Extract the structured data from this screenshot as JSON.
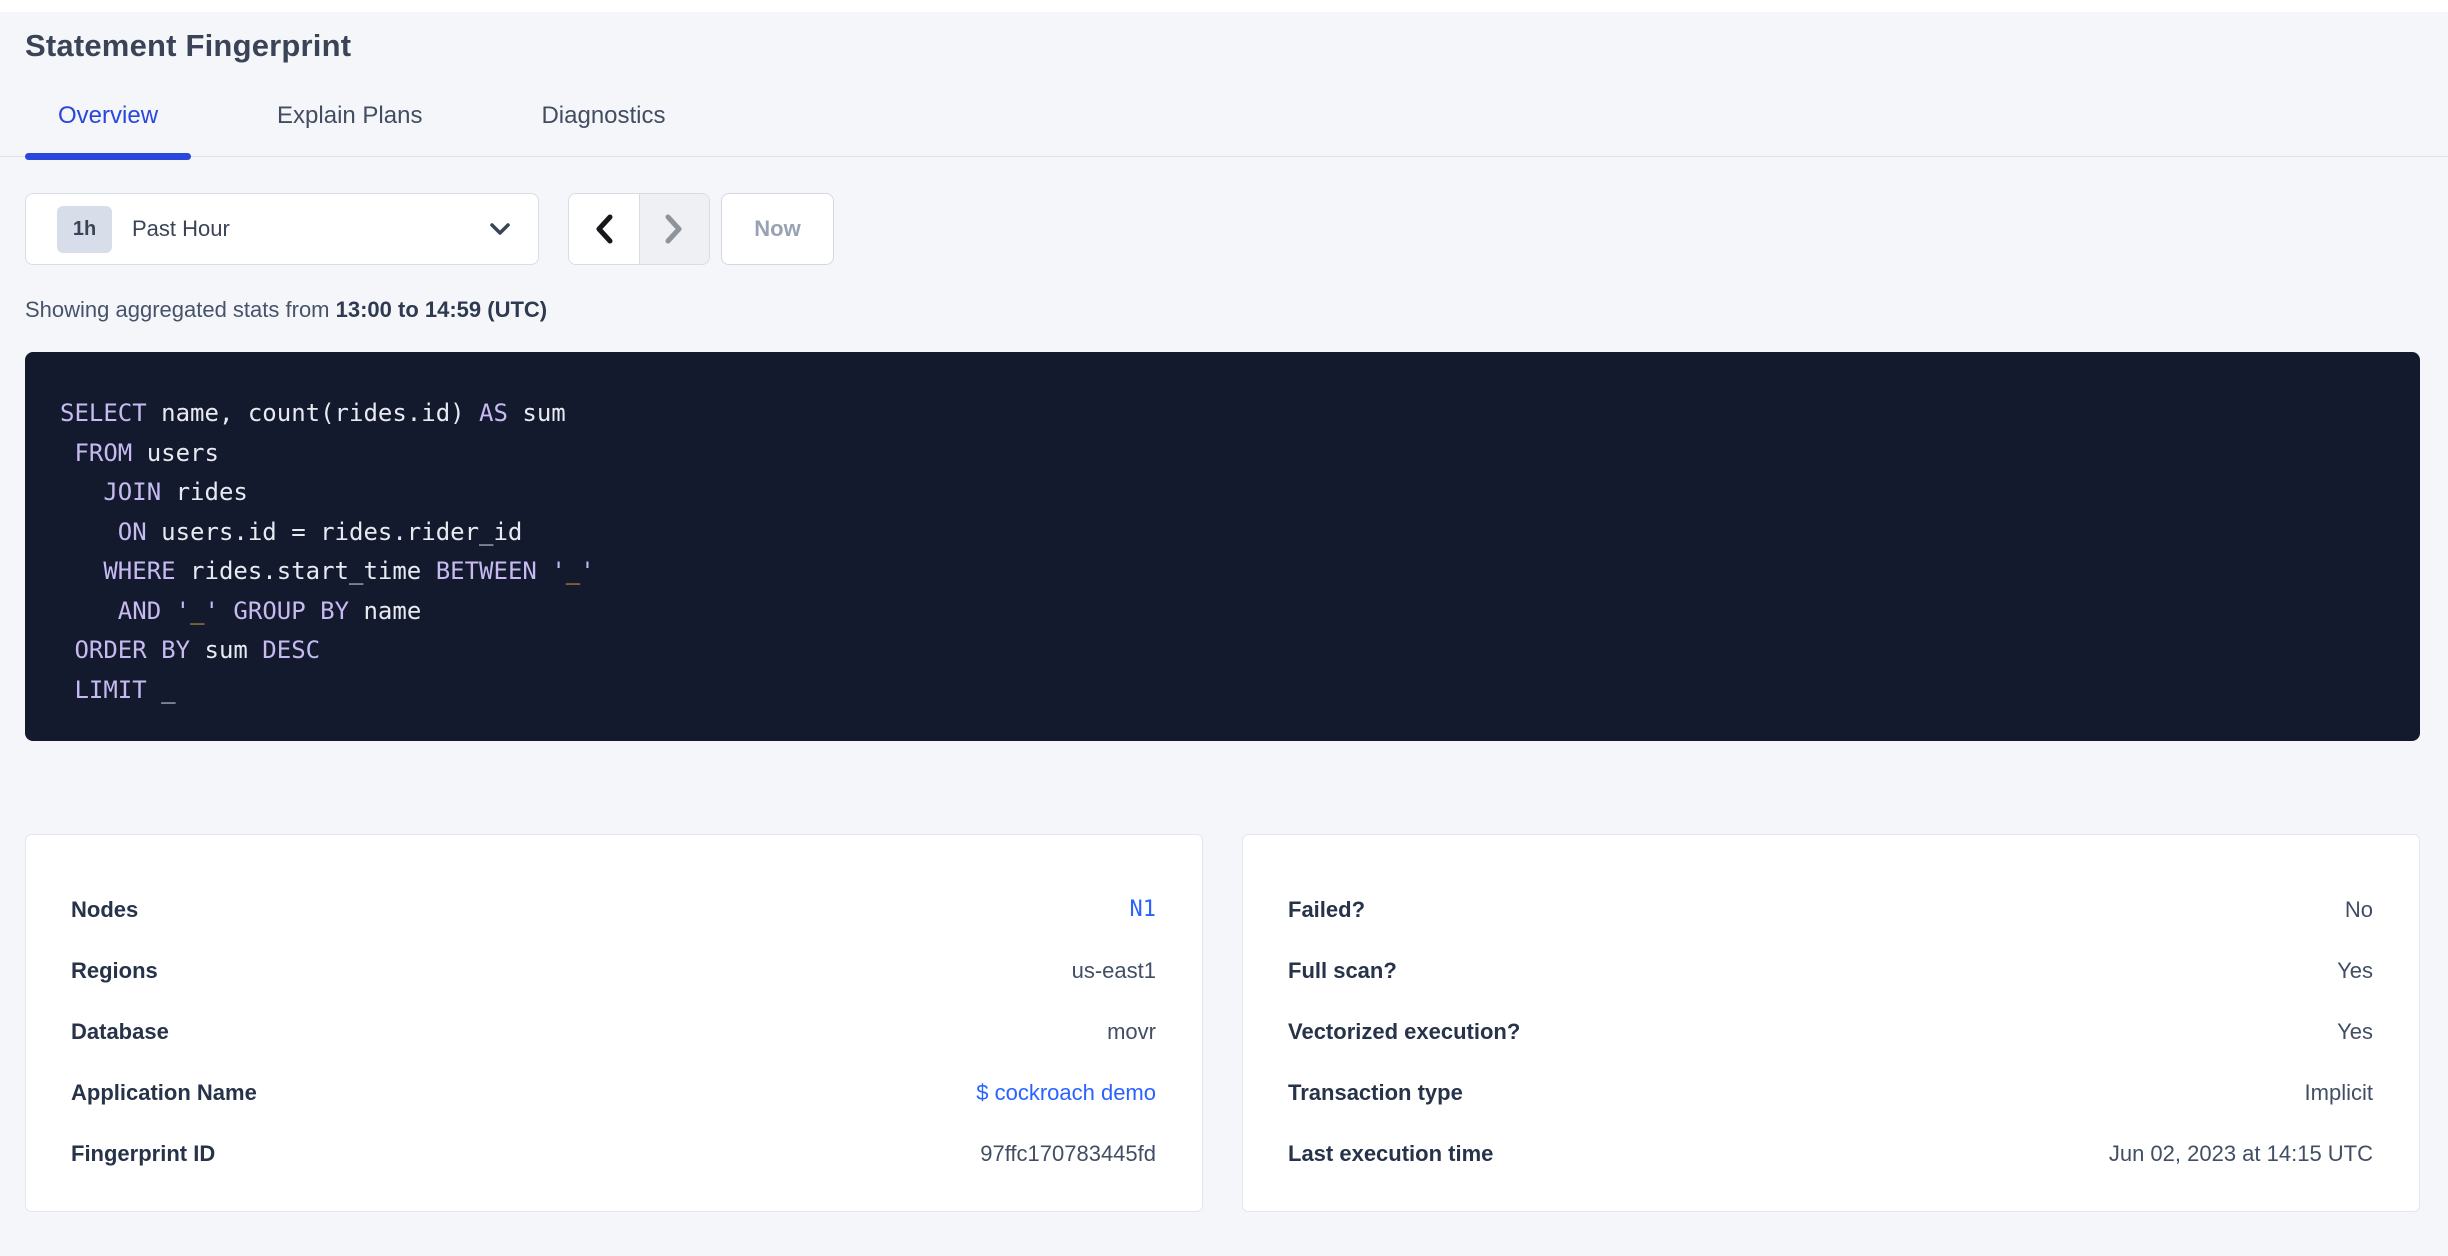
{
  "page_title": "Statement Fingerprint",
  "tabs": [
    {
      "label": "Overview",
      "active": true
    },
    {
      "label": "Explain Plans",
      "active": false
    },
    {
      "label": "Diagnostics",
      "active": false
    }
  ],
  "time_picker": {
    "badge": "1h",
    "selected": "Past Hour"
  },
  "pager": {
    "now_label": "Now"
  },
  "stats_line": {
    "prefix": "Showing aggregated stats from ",
    "bold_range": "13:00 to 14:59 (UTC)"
  },
  "sql": {
    "lines": [
      [
        [
          "kw",
          "SELECT"
        ],
        [
          "id",
          " name, count(rides.id) "
        ],
        [
          "kw",
          "AS"
        ],
        [
          "id",
          " sum"
        ]
      ],
      [
        [
          "id",
          " "
        ],
        [
          "kw",
          "FROM"
        ],
        [
          "id",
          " users"
        ]
      ],
      [
        [
          "id",
          "   "
        ],
        [
          "kw",
          "JOIN"
        ],
        [
          "id",
          " rides"
        ]
      ],
      [
        [
          "id",
          "    "
        ],
        [
          "kw",
          "ON"
        ],
        [
          "id",
          " users.id = rides.rider_id"
        ]
      ],
      [
        [
          "id",
          "   "
        ],
        [
          "kw",
          "WHERE"
        ],
        [
          "id",
          " rides.start_time "
        ],
        [
          "kw",
          "BETWEEN"
        ],
        [
          "id",
          " "
        ],
        [
          "q",
          "'"
        ],
        [
          "str",
          "_"
        ],
        [
          "q",
          "'"
        ]
      ],
      [
        [
          "id",
          "    "
        ],
        [
          "kw",
          "AND"
        ],
        [
          "id",
          " "
        ],
        [
          "q",
          "'"
        ],
        [
          "str",
          "_"
        ],
        [
          "q",
          "'"
        ],
        [
          "id",
          " "
        ],
        [
          "kw",
          "GROUP BY"
        ],
        [
          "id",
          " name"
        ]
      ],
      [
        [
          "id",
          " "
        ],
        [
          "kw",
          "ORDER BY"
        ],
        [
          "id",
          " sum "
        ],
        [
          "kw",
          "DESC"
        ]
      ],
      [
        [
          "id",
          " "
        ],
        [
          "kw",
          "LIMIT"
        ],
        [
          "id",
          " _"
        ]
      ]
    ]
  },
  "cards": {
    "left": {
      "rows": [
        {
          "label": "Nodes",
          "value": "N1",
          "link": true,
          "mono": true
        },
        {
          "label": "Regions",
          "value": "us-east1"
        },
        {
          "label": "Database",
          "value": "movr"
        },
        {
          "label": "Application Name",
          "value": "$ cockroach demo",
          "link": true
        },
        {
          "label": "Fingerprint ID",
          "value": "97ffc170783445fd"
        }
      ]
    },
    "right": {
      "rows": [
        {
          "label": "Failed?",
          "value": "No"
        },
        {
          "label": "Full scan?",
          "value": "Yes"
        },
        {
          "label": "Vectorized execution?",
          "value": "Yes"
        },
        {
          "label": "Transaction type",
          "value": "Implicit"
        },
        {
          "label": "Last execution time",
          "value": "Jun 02, 2023 at 14:15 UTC"
        }
      ]
    }
  },
  "colors": {
    "page_bg": "#f4f6fa",
    "accent_blue": "#2946dd",
    "link_blue": "#2962ff",
    "sql_bg": "#141a2d",
    "sql_keyword": "#c6baf1",
    "sql_identifier": "#e8eaf2",
    "sql_string": "#e9a43e"
  }
}
